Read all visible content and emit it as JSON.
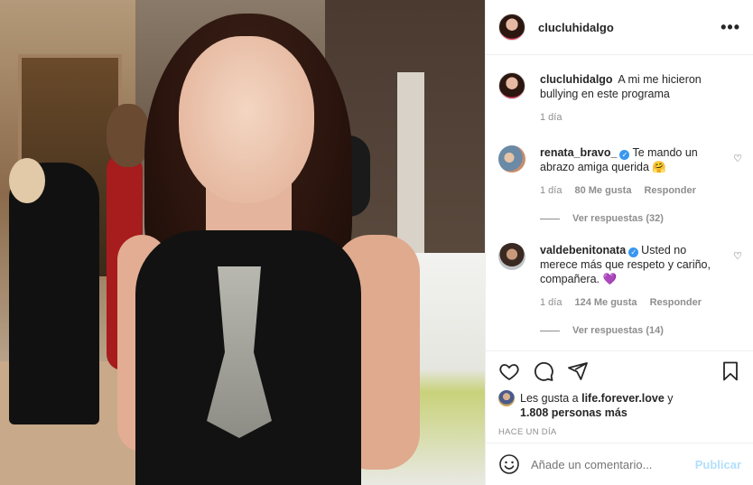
{
  "post": {
    "username": "cluclu hidalgo",
    "caption": "A mi me hicieron bullying en este programa",
    "caption_time": "1 día"
  },
  "header": {
    "username": "clucluhidalgo",
    "more": "•••"
  },
  "comments": [
    {
      "username": "renata_bravo_",
      "text": "Te mando un abrazo amiga querida 🤗",
      "time": "1 día",
      "likes": "80 Me gusta",
      "reply": "Responder",
      "view_replies": "Ver respuestas (32)"
    },
    {
      "username": "valdebenitonata",
      "text": "Usted no merece más que respeto y cariño, compañera. 💜",
      "time": "1 día",
      "likes": "124 Me gusta",
      "reply": "Responder",
      "view_replies": "Ver respuestas (14)"
    }
  ],
  "likes": {
    "prefix": "Les gusta a ",
    "user": "life.forever.love",
    "joiner": " y",
    "count": "1.808 personas más"
  },
  "when": "HACE UN DÍA",
  "add_comment": {
    "placeholder": "Añade un comentario...",
    "publish": "Publicar"
  },
  "icons": {
    "more": "more-options-icon",
    "heart": "heart-icon",
    "comment": "comment-icon",
    "share": "share-icon",
    "save": "bookmark-icon",
    "emoji": "emoji-icon"
  },
  "colors": {
    "link": "#3897f0",
    "publish_disabled": "#b2dffc",
    "muted": "#8e8e8e",
    "text": "#262626"
  }
}
